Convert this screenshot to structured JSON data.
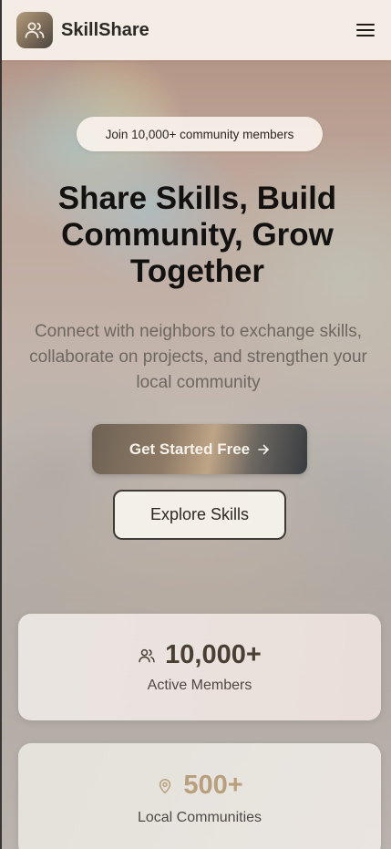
{
  "header": {
    "brand": "SkillShare",
    "logo_icon": "users-icon",
    "menu_icon": "hamburger-menu-icon"
  },
  "hero": {
    "pill_text": "Join 10,000+ community members",
    "headline_line1": "Share Skills, Build",
    "headline_line2": "Community, Grow",
    "headline_line3": "Together",
    "subtext": "Connect with neighbors to exchange skills, collaborate on projects, and strengthen your local community",
    "primary_cta": "Get Started Free",
    "primary_cta_icon": "arrow-right-icon",
    "secondary_cta": "Explore Skills"
  },
  "stats": [
    {
      "icon": "users-icon",
      "value": "10,000+",
      "label": "Active Members"
    },
    {
      "icon": "map-pin-icon",
      "value": "500+",
      "label": "Local Communities"
    }
  ],
  "colors": {
    "header_bg": "#f6f0ea",
    "headline": "#141210",
    "subtext": "#6e6760",
    "accent_warm": "#b8a07e",
    "dark": "#2c2824"
  }
}
